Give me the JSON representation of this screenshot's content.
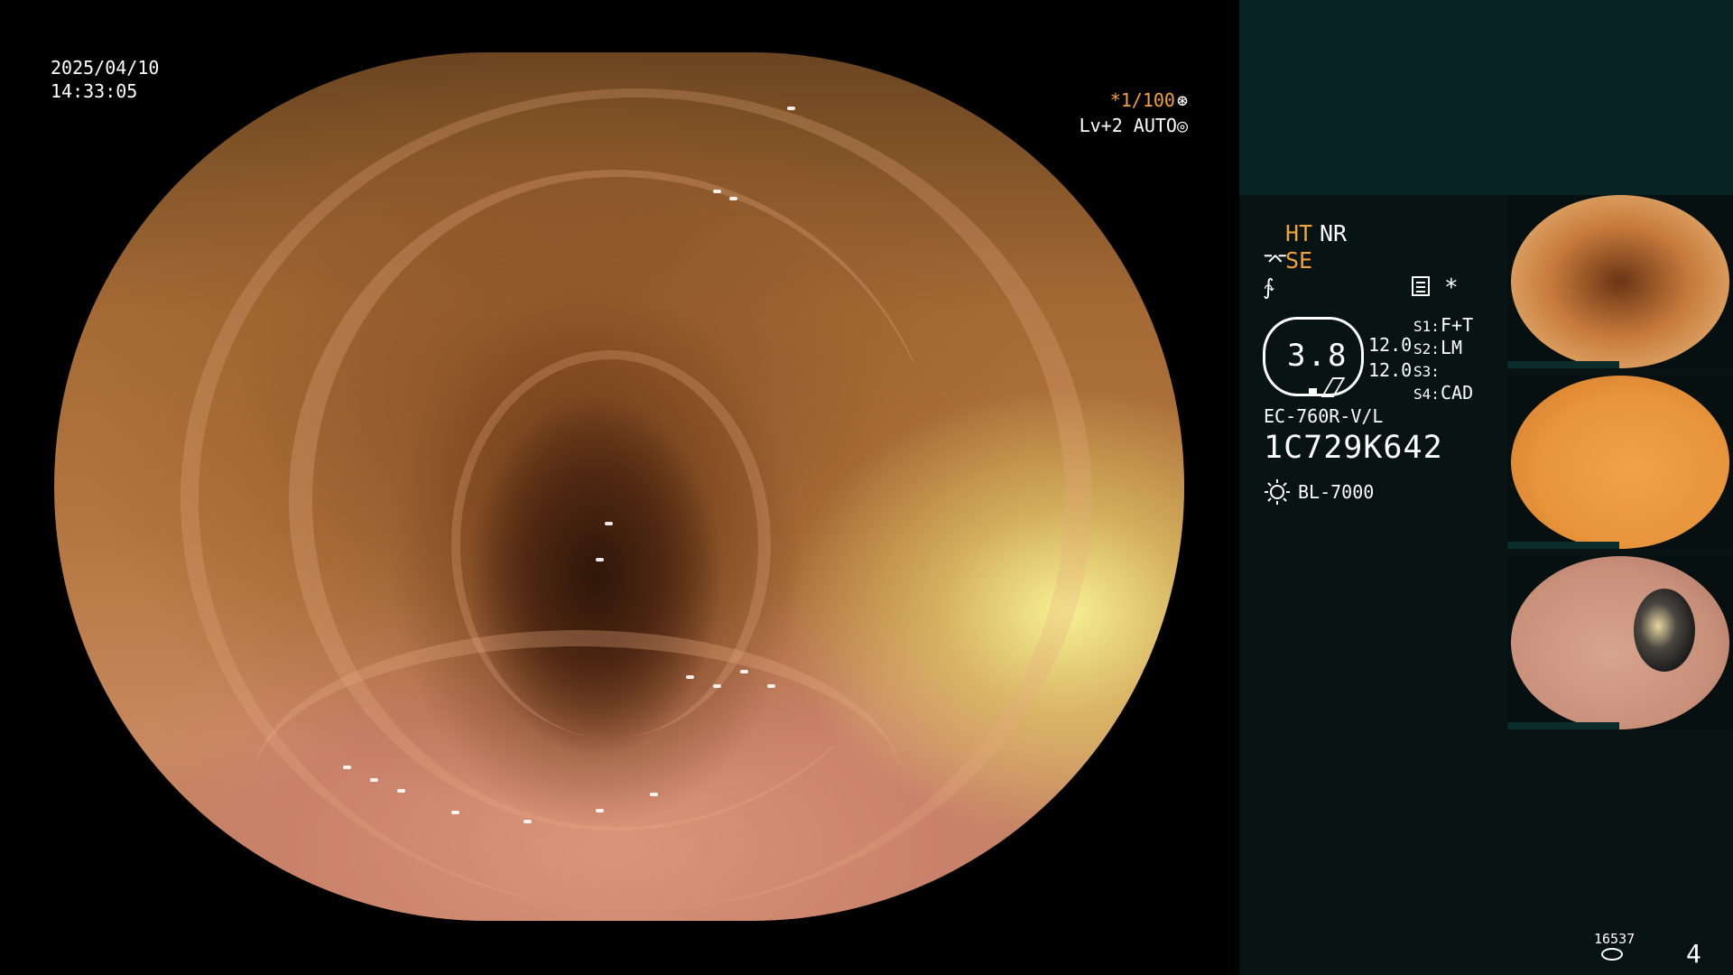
{
  "overlay": {
    "date": "2025/04/10",
    "time": "14:33:05",
    "shutter": "*1/100",
    "level": "Lv+2 AUTO"
  },
  "settings": {
    "ht": "HT",
    "nr": "NR",
    "se": "SE"
  },
  "zoom": {
    "value": "3.8",
    "val1": "12.0",
    "val2": "12.0"
  },
  "switches": [
    {
      "key": "S1:",
      "value": "F+T"
    },
    {
      "key": "S2:",
      "value": "LM"
    },
    {
      "key": "S3:",
      "value": ""
    },
    {
      "key": "S4:",
      "value": "CAD"
    }
  ],
  "scope": {
    "model": "EC-760R-V/L",
    "serial": "1C729K642",
    "light_source": "BL-7000"
  },
  "status": {
    "storage_count": "16537",
    "image_number": "4"
  },
  "icons": [
    "freeze-icon",
    "aperture-icon",
    "scope-tip-icon",
    "frequency-icon",
    "settings-icon",
    "light-source-icon",
    "storage-icon"
  ]
}
